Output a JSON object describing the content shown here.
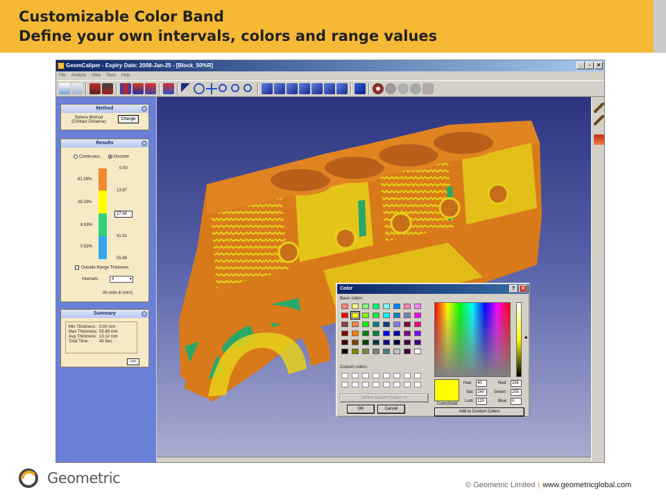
{
  "slide": {
    "title_line1": "Customizable Color Band",
    "title_line2": "Define your own intervals, colors and range values",
    "header_color": "#f6b935",
    "footer_company": "© Geometric Limited",
    "footer_separator": "|",
    "footer_url": "www.geometricglobal.com",
    "logo_text": "Geometric"
  },
  "app": {
    "window_title": "GeomCaliper - Expiry Date: 2008-Jan-25 - [Block_50%R]",
    "menu": [
      "File",
      "Analyze",
      "View",
      "Tools",
      "Help"
    ],
    "window_buttons": [
      "_",
      "▫",
      "✕"
    ]
  },
  "method_panel": {
    "heading": "Method",
    "method_name": "Sphere Method",
    "method_detail": "(Contact Distance)",
    "change_label": "Change"
  },
  "results_panel": {
    "heading": "Results",
    "option_continuous": "Continuous",
    "option_discrete": "Discrete",
    "selected_option": "Discrete",
    "bands": [
      {
        "percent": "61.26%",
        "color": "#f08a2c"
      },
      {
        "percent": "29.29%",
        "color": "#ffff00"
      },
      {
        "percent": "8.93%",
        "color": "#33d07a"
      },
      {
        "percent": "0.52%",
        "color": "#33a8f0"
      }
    ],
    "range_values": [
      "0.00",
      "13.97",
      "27.94",
      "41.91",
      "55.89"
    ],
    "editable_value": "27.94",
    "outside_range_label": "Outside Range Thickness",
    "intervals_label": "Intervals:",
    "intervals_value": "4",
    "units_note": "All units in (mm)"
  },
  "summary_panel": {
    "heading": "Summary",
    "rows": [
      {
        "label": "Min Thickness:",
        "value": "0.00 mm"
      },
      {
        "label": "Max Thickness:",
        "value": "55.89 mm"
      },
      {
        "label": "Avg Thickness:",
        "value": "13.12 mm"
      },
      {
        "label": "Total Time:",
        "value": "40 Sec"
      }
    ],
    "next_label": ">>"
  },
  "color_dialog": {
    "title": "Color",
    "help_button": "?",
    "close_button": "✕",
    "basic_colors_label": "Basic colors:",
    "basic_colors": [
      [
        "#ff8080",
        "#ffff80",
        "#80ff80",
        "#00ff80",
        "#80ffff",
        "#0080ff",
        "#ff80c0",
        "#ff80ff"
      ],
      [
        "#ff0000",
        "#ffff00",
        "#80ff00",
        "#00ff40",
        "#00ffff",
        "#0080c0",
        "#8080c0",
        "#ff00ff"
      ],
      [
        "#804040",
        "#ff8040",
        "#00ff00",
        "#008080",
        "#004080",
        "#8080ff",
        "#800040",
        "#ff0080"
      ],
      [
        "#800000",
        "#ff8000",
        "#008000",
        "#008040",
        "#0000ff",
        "#0000a0",
        "#800080",
        "#8000ff"
      ],
      [
        "#400000",
        "#804000",
        "#004000",
        "#004040",
        "#000080",
        "#000040",
        "#400040",
        "#400080"
      ],
      [
        "#000000",
        "#808000",
        "#808040",
        "#808080",
        "#408080",
        "#c0c0c0",
        "#400040",
        "#ffffff"
      ]
    ],
    "selected_swatch": "#ffff00",
    "custom_colors_label": "Custom colors:",
    "define_custom_label": "Define Custom Colors >>",
    "ok_label": "OK",
    "cancel_label": "Cancel",
    "color_solid_label": "Color|Solid",
    "preview_color": "#ffff00",
    "hue_label": "Hue:",
    "hue_value": "40",
    "sat_label": "Sat:",
    "sat_value": "240",
    "lum_label": "Lum:",
    "lum_value": "120",
    "red_label": "Red:",
    "red_value": "255",
    "green_label": "Green:",
    "green_value": "255",
    "blue_label": "Blue:",
    "blue_value": "0",
    "add_custom_label": "Add to Custom Colors"
  }
}
